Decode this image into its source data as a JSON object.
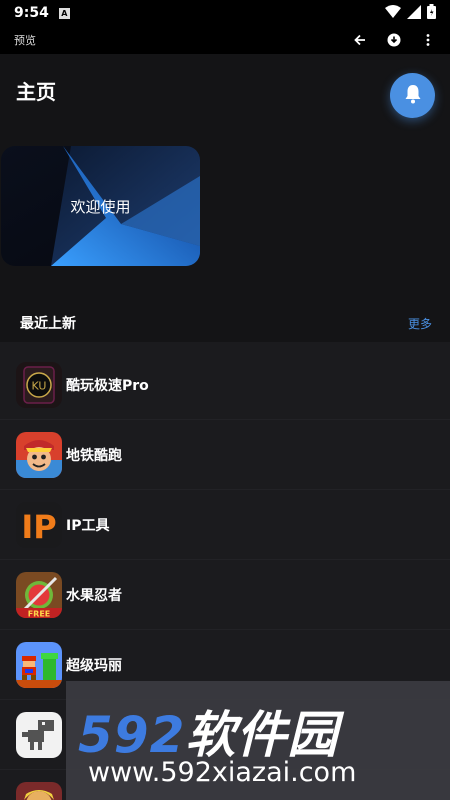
{
  "status_bar": {
    "time": "9:54",
    "notification_glyph": "A",
    "icons": [
      "wifi-icon",
      "signal-icon",
      "battery-icon"
    ]
  },
  "toolbar": {
    "title": "预览",
    "icons": [
      "back-arrow-icon",
      "download-icon",
      "more-vert-icon"
    ]
  },
  "header": {
    "title": "主页",
    "bell_icon": "bell-icon"
  },
  "banner": {
    "text": "欢迎使用"
  },
  "section": {
    "title": "最近上新",
    "more_label": "更多"
  },
  "apps": [
    {
      "name": "酷玩极速Pro",
      "icon": "kuwan-app-icon"
    },
    {
      "name": "地铁酷跑",
      "icon": "subway-surfers-icon"
    },
    {
      "name": "IP工具",
      "icon": "ip-tool-icon",
      "icon_text": "IP"
    },
    {
      "name": "水果忍者",
      "icon": "fruit-ninja-icon"
    },
    {
      "name": "超级玛丽",
      "icon": "super-mario-icon"
    },
    {
      "name": "",
      "icon": "dino-game-icon"
    },
    {
      "name": "",
      "icon": "game-icon"
    }
  ],
  "watermark": {
    "brand_num": "592",
    "brand_cn": "软件园",
    "url": "www.592xiazai.com"
  },
  "colors": {
    "background": "#141416",
    "list_background": "#1b1b1e",
    "accent": "#4a90e2"
  }
}
